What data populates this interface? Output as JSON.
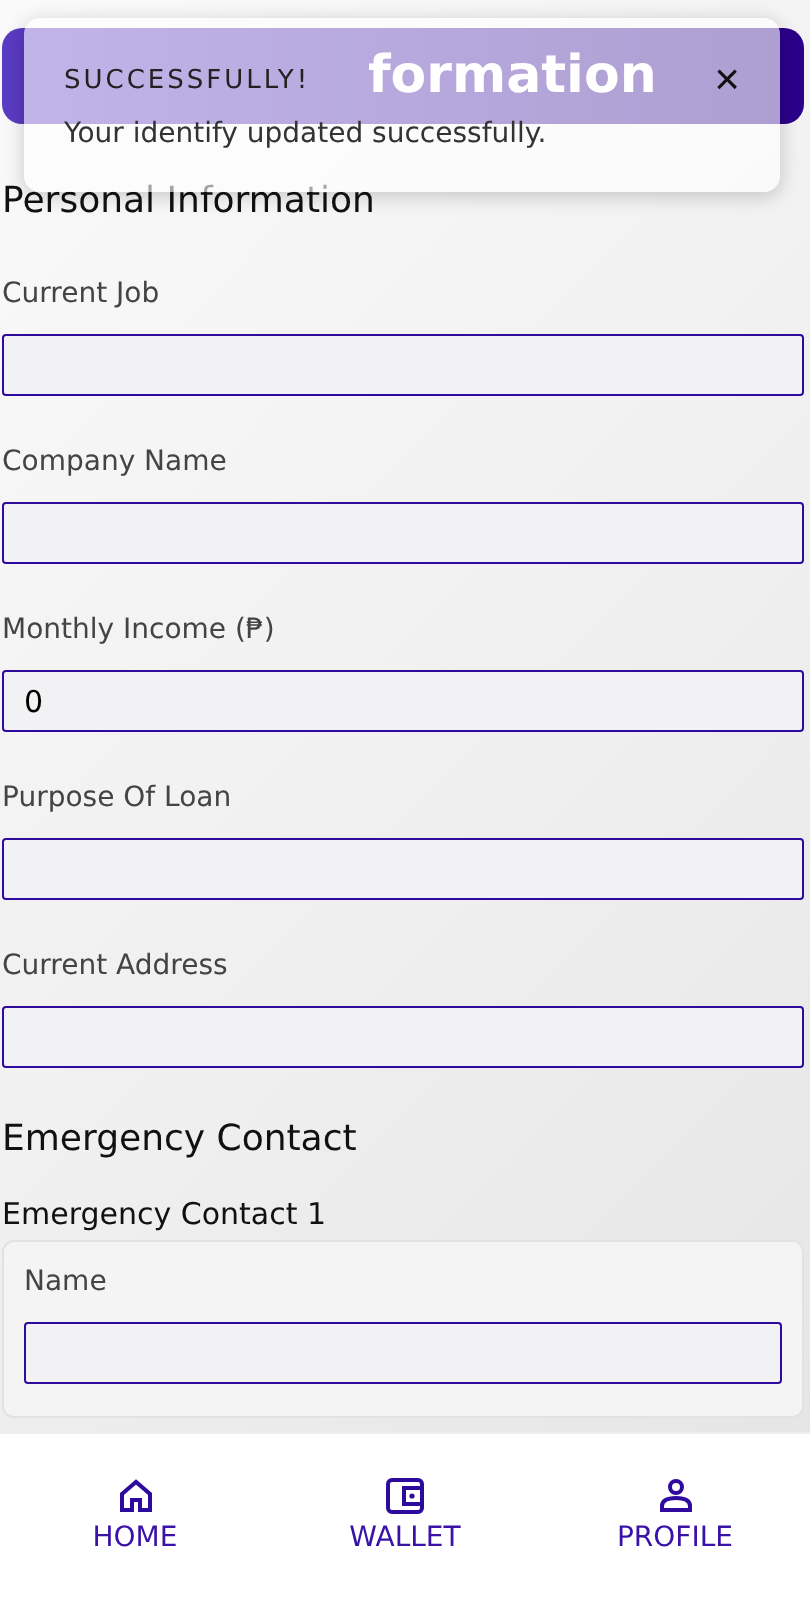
{
  "header": {
    "title": "formation"
  },
  "toast": {
    "title": "SUCCESSFULLY!",
    "message": "Your identify updated successfully.",
    "close": "×"
  },
  "personal": {
    "heading": "Personal Information",
    "fields": [
      {
        "label": "Current Job"
      },
      {
        "label": "Company Name"
      },
      {
        "label": "Monthly Income (₱)",
        "value": "0"
      },
      {
        "label": "Purpose Of Loan"
      },
      {
        "label": "Current Address"
      }
    ]
  },
  "emergency": {
    "heading": "Emergency Contact",
    "contacts": [
      {
        "title": "Emergency Contact 1",
        "fields": [
          {
            "label": "Name"
          }
        ]
      }
    ]
  },
  "nav": [
    {
      "label": "HOME"
    },
    {
      "label": "WALLET"
    },
    {
      "label": "PROFILE"
    }
  ]
}
